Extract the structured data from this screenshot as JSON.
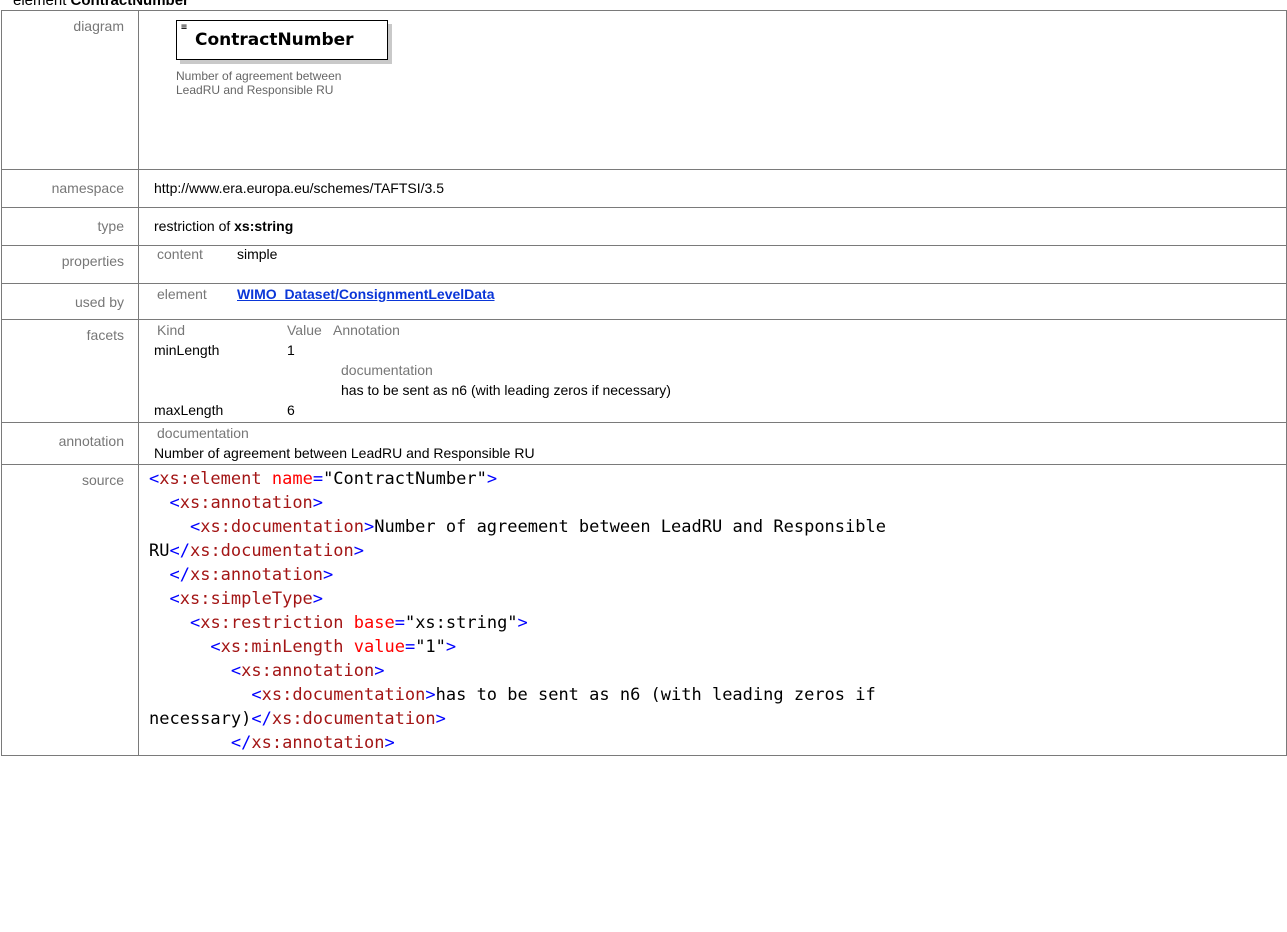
{
  "heading": {
    "prefix": "element ",
    "name": "ContractNumber"
  },
  "rows": {
    "diagram": {
      "label": "diagram",
      "element_name": "ContractNumber",
      "element_doc": "Number of agreement between LeadRU and Responsible RU"
    },
    "namespace": {
      "label": "namespace",
      "value": "http://www.era.europa.eu/schemes/TAFTSI/3.5"
    },
    "type": {
      "label": "type",
      "prefix": "restriction of ",
      "base": "xs:string"
    },
    "properties": {
      "label": "properties",
      "key": "content",
      "value": "simple"
    },
    "used_by": {
      "label": "used by",
      "key": "element",
      "link": "WIMO_Dataset/ConsignmentLevelData"
    },
    "facets": {
      "label": "facets",
      "headers": [
        "Kind",
        "Value",
        "Annotation"
      ],
      "items": [
        {
          "kind": "minLength",
          "value": "1",
          "doc_label": "documentation",
          "doc_text": "has to be sent as n6 (with leading zeros if necessary)"
        },
        {
          "kind": "maxLength",
          "value": "6"
        }
      ]
    },
    "annotation": {
      "label": "annotation",
      "doc_label": "documentation",
      "doc_text": "Number of agreement between LeadRU and Responsible RU"
    },
    "source": {
      "label": "source",
      "l1_tag": "xs:element",
      "l1_attr": "name",
      "l1_val": "\"ContractNumber\"",
      "l2_tag": "xs:annotation",
      "l3_tag": "xs:documentation",
      "l3_text": "Number of agreement between LeadRU and Responsible",
      "l4_text": "RU",
      "l4_close": "xs:documentation",
      "l5_close": "xs:annotation",
      "l6_tag": "xs:simpleType",
      "l7_tag": "xs:restriction",
      "l7_attr": "base",
      "l7_val": "\"xs:string\"",
      "l8_tag": "xs:minLength",
      "l8_attr": "value",
      "l8_val": "\"1\"",
      "l9_tag": "xs:annotation",
      "l10_tag": "xs:documentation",
      "l10_text": "has to be sent as n6 (with leading zeros if",
      "l11_text": "necessary)",
      "l11_close": "xs:documentation",
      "l12_close": "xs:annotation"
    }
  }
}
